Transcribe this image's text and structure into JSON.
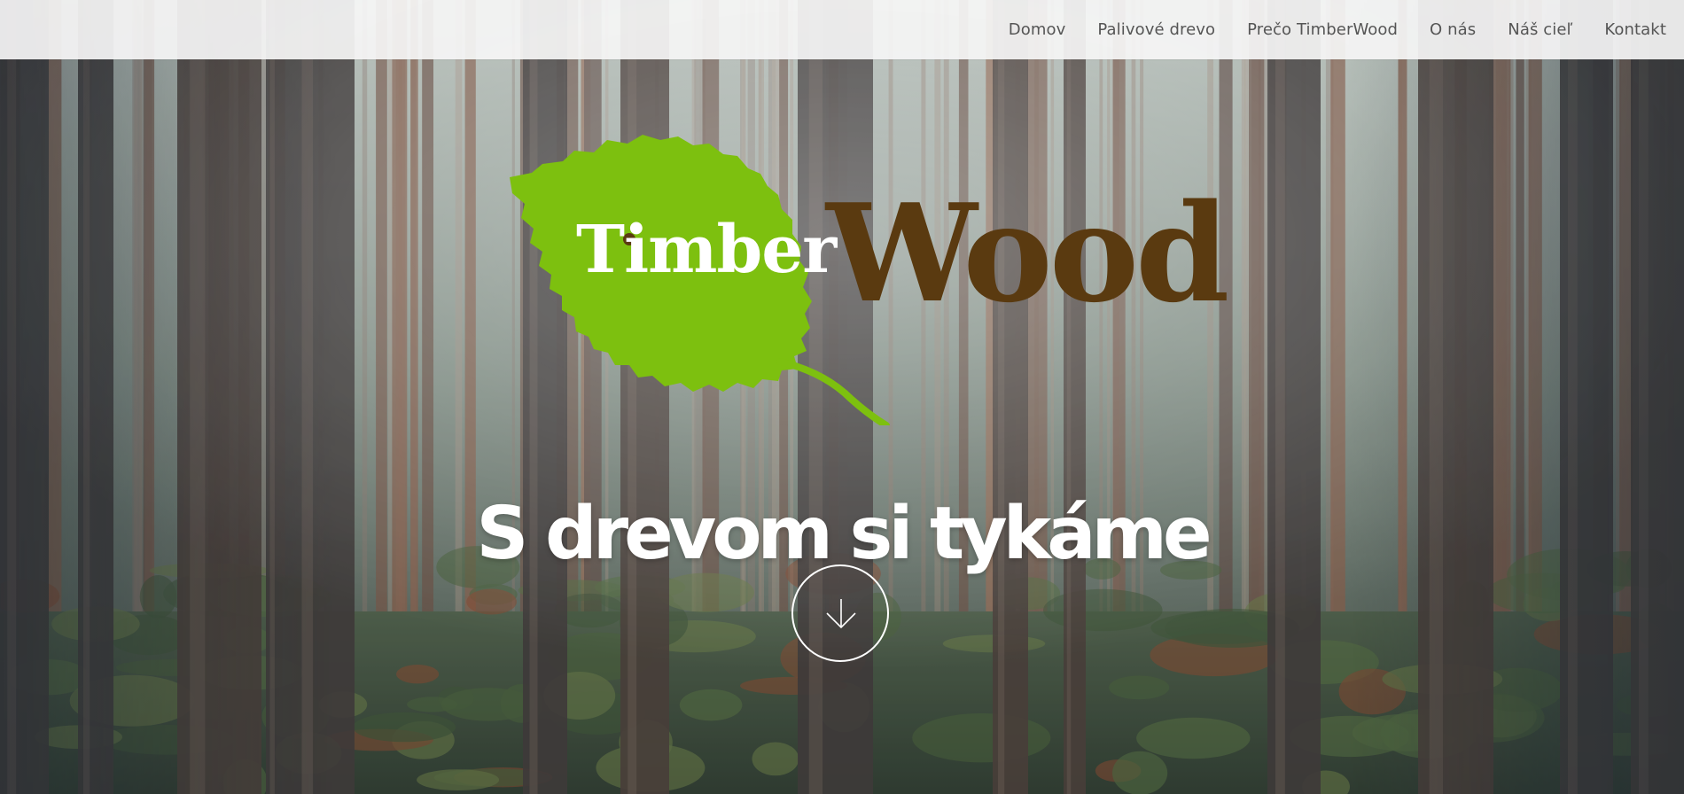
{
  "nav": {
    "items": [
      {
        "label": "Domov"
      },
      {
        "label": "Palivové drevo"
      },
      {
        "label": "Prečo TimberWood"
      },
      {
        "label": "O nás"
      },
      {
        "label": "Náš cieľ"
      },
      {
        "label": "Kontakt"
      }
    ]
  },
  "hero": {
    "logo_part1": "Timber",
    "logo_part2": "Wood",
    "tagline": "S drevom si tykáme",
    "scroll_icon": "arrow-down-icon"
  },
  "colors": {
    "leaf_green": "#7dc00f",
    "wood_brown": "#5a3a10",
    "nav_text": "#555555",
    "nav_background": "#f5f5f5"
  }
}
